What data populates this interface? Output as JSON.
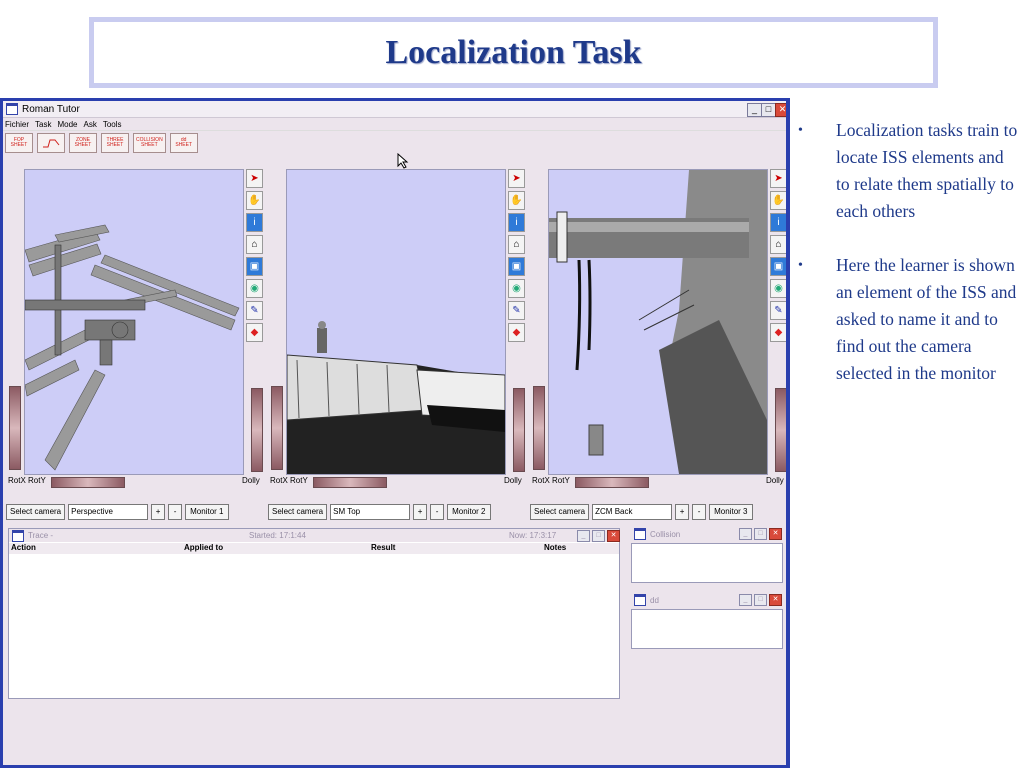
{
  "slide": {
    "title": "Localization Task",
    "bullets": [
      "Localization tasks train to locate ISS elements and to relate them spatially to each others",
      "Here the learner is shown an element of the ISS and asked to name it and to find out the camera selected in the monitor"
    ]
  },
  "window": {
    "title": "Roman Tutor",
    "menu": [
      "Fichier",
      "Task",
      "Mode",
      "Ask",
      "Tools"
    ],
    "toolbar": [
      {
        "line1": "FOP",
        "line2": "SHEET"
      },
      {
        "line1": "",
        "line2": ""
      },
      {
        "line1": "ZONE",
        "line2": "SHEET"
      },
      {
        "line1": "THREE",
        "line2": "SHEET"
      },
      {
        "line1": "COLLISION",
        "line2": "SHEET"
      },
      {
        "line1": "dd",
        "line2": "SHEET"
      }
    ]
  },
  "viewports": [
    {
      "rot_label": "RotX RotY",
      "dolly_label": "Dolly",
      "select_label": "Select camera",
      "camera": "Perspective",
      "plus": "+",
      "minus": "-",
      "monitor": "Monitor 1"
    },
    {
      "rot_label": "RotX RotY",
      "dolly_label": "Dolly",
      "select_label": "Select camera",
      "camera": "SM Top",
      "plus": "+",
      "minus": "-",
      "monitor": "Monitor 2"
    },
    {
      "rot_label": "RotX RotY",
      "dolly_label": "Dolly",
      "select_label": "Select camera",
      "camera": "ZCM Back",
      "plus": "+",
      "minus": "-",
      "monitor": "Monitor 3"
    }
  ],
  "trace": {
    "title": "Trace -",
    "started": "Started: 17:1:44",
    "now": "Now: 17:3:17",
    "columns": [
      "Action",
      "Applied to",
      "Result",
      "Notes"
    ]
  },
  "panels": {
    "collision": "Collision",
    "dd": "dd"
  },
  "colors": {
    "title": "#1f3a8a",
    "window_border": "#2a3fae",
    "scene_bg": "#cdcdf7"
  }
}
